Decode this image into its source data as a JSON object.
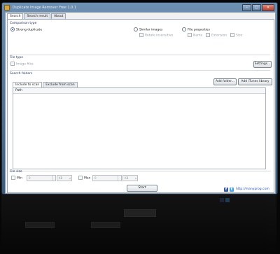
{
  "window": {
    "title": "Duplicate Image Remover Free 1.0.1",
    "buttons": {
      "minimize": "–",
      "maximize": "□",
      "close": "✕"
    }
  },
  "tabs": [
    {
      "label": "Search"
    },
    {
      "label": "Search result"
    },
    {
      "label": "About"
    }
  ],
  "comparison": {
    "group_label": "Comparison type",
    "strong_duplicate": "Strong duplicate",
    "similar_images": "Similar images",
    "rotate_insensitive": "Rotate insensitive",
    "file_properties": "File properties",
    "prop_name": "Name",
    "prop_extension": "Extension",
    "prop_size": "Size"
  },
  "file_type": {
    "group_label": "File type",
    "image_files": "Image files",
    "settings_button": "Settings..."
  },
  "search_folders": {
    "group_label": "Search folders",
    "add_folder_button": "Add folder...",
    "add_itunes_button": "Add iTunes library",
    "subtabs": [
      {
        "label": "Include to scan"
      },
      {
        "label": "Exclude from scan"
      }
    ],
    "column_path": "Path"
  },
  "file_size": {
    "group_label": "File size",
    "min_label": "Min",
    "max_label": "Max",
    "min_value": "0",
    "max_value": "0",
    "min_unit": "KB",
    "max_unit": "KB"
  },
  "start_button": "Start",
  "footer": {
    "url": "http://manyprog.com"
  },
  "colors": {
    "facebook": "#3b5998",
    "twitter": "#4aa3df",
    "accent": "#2a5db0"
  }
}
